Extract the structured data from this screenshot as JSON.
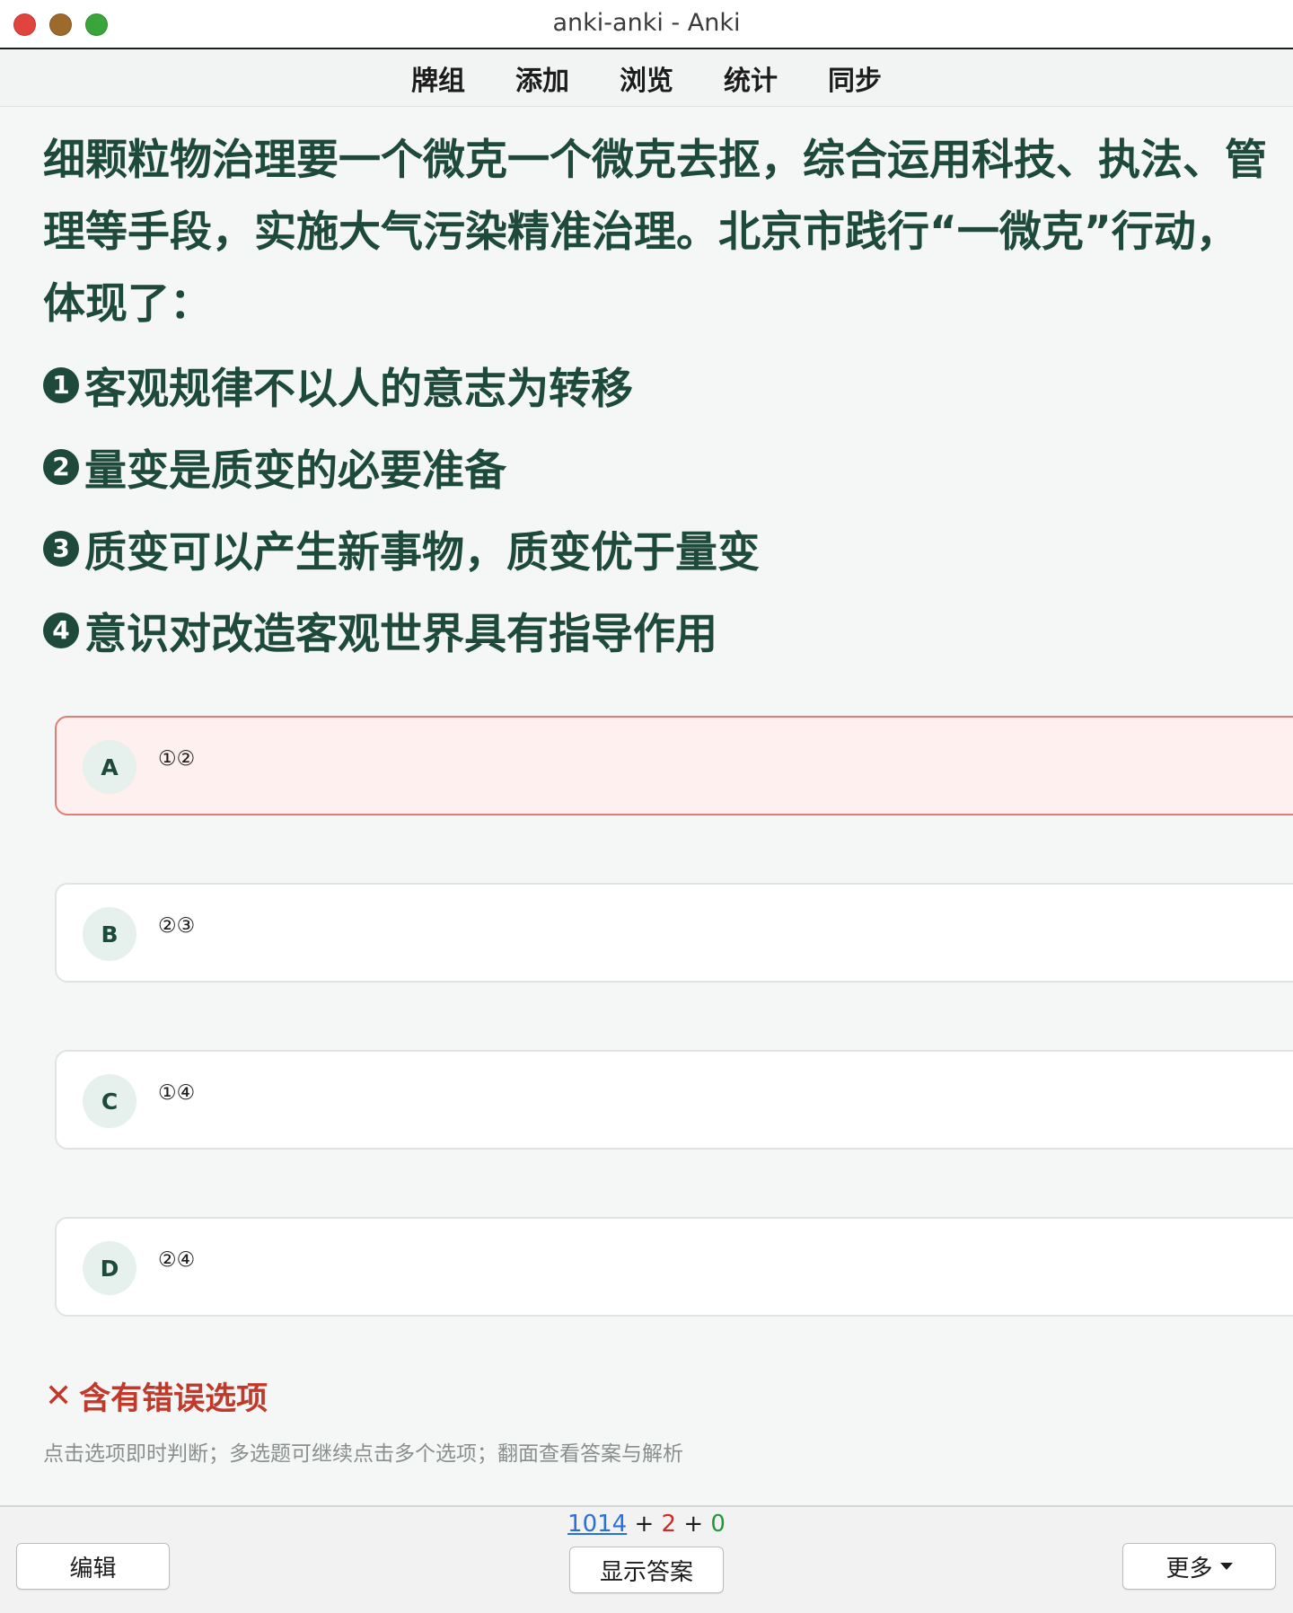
{
  "window": {
    "title": "anki-anki - Anki"
  },
  "top_menu": {
    "items": [
      {
        "label": "牌组"
      },
      {
        "label": "添加"
      },
      {
        "label": "浏览"
      },
      {
        "label": "统计"
      },
      {
        "label": "同步"
      }
    ]
  },
  "card": {
    "question": "细颗粒物治理要一个微克一个微克去抠，综合运用科技、执法、管理等手段，实施大气污染精准治理。北京市践行“一微克”行动，体现了：",
    "statements": [
      {
        "num": "1",
        "text": "客观规律不以人的意志为转移"
      },
      {
        "num": "2",
        "text": "量变是质变的必要准备"
      },
      {
        "num": "3",
        "text": "质变可以产生新事物，质变优于量变"
      },
      {
        "num": "4",
        "text": "意识对改造客观世界具有指导作用"
      }
    ],
    "options": [
      {
        "letter": "A",
        "text": "①②",
        "state": "wrong"
      },
      {
        "letter": "B",
        "text": "②③",
        "state": "normal"
      },
      {
        "letter": "C",
        "text": "①④",
        "state": "normal"
      },
      {
        "letter": "D",
        "text": "②④",
        "state": "normal"
      }
    ],
    "result": {
      "icon": "✕",
      "text": "含有错误选项",
      "color": "#c0392b"
    },
    "hint": "点击选项即时判断；多选题可继续点击多个选项；翻面查看答案与解析"
  },
  "bottom_bar": {
    "edit_label": "编辑",
    "show_answer_label": "显示答案",
    "more_label": "更多",
    "counts": {
      "new": "1014",
      "learn": "2",
      "review": "0",
      "sep": "+"
    }
  },
  "colors": {
    "accent": "#1e4a3b",
    "wrong_bg": "#fff0f0",
    "wrong_border": "#e07d77",
    "new_count": "#2a6fdb",
    "learn_count": "#d62626",
    "review_count": "#1f9a3a"
  }
}
